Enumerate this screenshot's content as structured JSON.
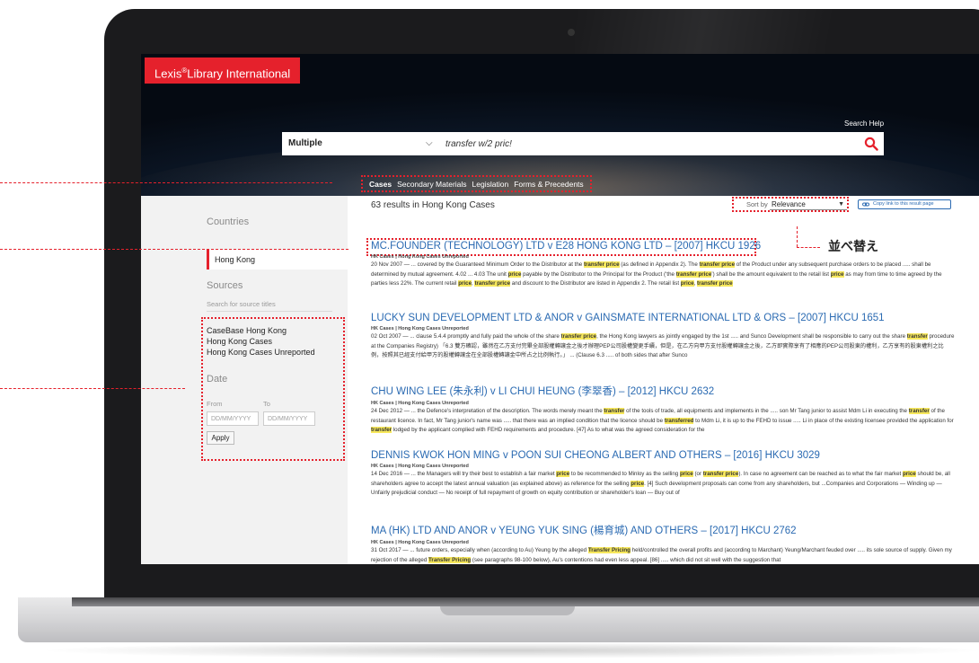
{
  "app": {
    "logo_text": "Lexis",
    "logo_reg": "®",
    "logo_suffix": "Library International"
  },
  "header": {
    "search_help": "Search Help",
    "search_scope": "Multiple",
    "search_query": "transfer w/2 pric!",
    "tabs": [
      {
        "label": "Cases",
        "active": true
      },
      {
        "label": "Secondary Materials",
        "active": false
      },
      {
        "label": "Legislation",
        "active": false
      },
      {
        "label": "Forms & Precedents",
        "active": false
      }
    ]
  },
  "sidebar": {
    "countries_heading": "Countries",
    "selected_country": "Hong Kong",
    "sources_heading": "Sources",
    "source_search_placeholder": "Search for source titles",
    "sources": [
      "CaseBase Hong Kong",
      "Hong Kong Cases",
      "Hong Kong Cases Unreported"
    ],
    "date_heading": "Date",
    "date_from_label": "From",
    "date_to_label": "To",
    "date_placeholder": "DD/MM/YYYY",
    "apply_label": "Apply"
  },
  "results": {
    "count_text": "63 results in Hong Kong Cases",
    "sort_label": "Sort by",
    "sort_value": "Relevance",
    "copy_link_label": "Copy link to this result page",
    "items": [
      {
        "title": "MC.FOUNDER (TECHNOLOGY) LTD v E28 HONG KONG LTD – [2007] HKCU 1926",
        "source": "HK Cases | Hong Kong Cases Unreported",
        "snippet": [
          [
            "20 Nov 2007 — ... covered by the Guaranteed Minimum Order to the Distributor at the ",
            false
          ],
          [
            "transfer price",
            true
          ],
          [
            " (as defined in Appendix 2). The ",
            false
          ],
          [
            "transfer price",
            true
          ],
          [
            " of the Product under any subsequent purchase orders to be placed ..... shall be determined by mutual agreement. 4.02 ... 4.03 The unit ",
            false
          ],
          [
            "price",
            true
          ],
          [
            " payable by the Distributor to the Principal for the Product (‘the ",
            false
          ],
          [
            "transfer price",
            true
          ],
          [
            "’) shall be the amount equivalent to the retail list ",
            false
          ],
          [
            "price",
            true
          ],
          [
            " as may from time to time agreed by the parties less 22%. The current retail ",
            false
          ],
          [
            "price",
            true
          ],
          [
            ", ",
            false
          ],
          [
            "transfer price",
            true
          ],
          [
            " and discount to the Distributor are listed in Appendix 2. The retail list ",
            false
          ],
          [
            "price",
            true
          ],
          [
            ", ",
            false
          ],
          [
            "transfer price",
            true
          ]
        ]
      },
      {
        "title": "LUCKY SUN DEVELOPMENT LTD & ANOR v GAINSMATE INTERNATIONAL LTD & ORS – [2007] HKCU 1651",
        "source": "HK Cases | Hong Kong Cases Unreported",
        "snippet": [
          [
            "02 Oct 2007 — ... clause 5.4.4 promptly and fully paid the whole of the share ",
            false
          ],
          [
            "transfer price",
            true
          ],
          [
            ", the Hong Kong lawyers as jointly engaged by the 1st ..... and Sunco Development shall be responsible to carry out the share ",
            false
          ],
          [
            "transfer",
            true
          ],
          [
            " procedure at the Companies Registry) 「6.3 雙方確認，雖然在乙方支付完畢全部股權轉讓金之後才辦理PEP公司股權變更手續，但是，在乙方向甲方支付股權轉讓金之後，乙方即實際享有了相應的PEP公司股東的權利，乙方享有的股東權利之比例，按照其已經支付給甲方的股權轉讓金在全部股權轉讓金中所占之比例執行。」 ... (Clause 6.3 ..... of both sides that after Sunco",
            false
          ]
        ]
      },
      {
        "title": "CHU WING LEE (朱永利) v LI CHUI HEUNG (李翠香) – [2012] HKCU 2632",
        "source": "HK Cases | Hong Kong Cases Unreported",
        "snippet": [
          [
            "24 Dec 2012 — ... the Defence's interpretation of the description. The words merely meant the ",
            false
          ],
          [
            "transfer",
            true
          ],
          [
            " of the tools of trade, all equipments and implements in the ..... son Mr Tang junior to assist Mdm Li in executing the ",
            false
          ],
          [
            "transfer",
            true
          ],
          [
            " of the restaurant licence. In fact, Mr Tang junior's name was ..... that there was an implied condition that the licence should be ",
            false
          ],
          [
            "transferred",
            true
          ],
          [
            " to Mdm Li, it is up to the FEHD to issue ..... Li in place of the existing licensee provided the application for ",
            false
          ],
          [
            "transfer",
            true
          ],
          [
            " lodged by the applicant complied with FEHD requirements and procedure. [47] As to what was the agreed consideration for the",
            false
          ]
        ]
      },
      {
        "title": "DENNIS KWOK HON MING v POON SUI CHEONG ALBERT AND OTHERS – [2016] HKCU 3029",
        "source": "HK Cases | Hong Kong Cases Unreported",
        "snippet": [
          [
            "14 Dec 2016 — ... the Managers will try their best to establish a fair market ",
            false
          ],
          [
            "price",
            true
          ],
          [
            " to be recommended to Minloy as the selling ",
            false
          ],
          [
            "price",
            true
          ],
          [
            " (or ",
            false
          ],
          [
            "transfer price",
            true
          ],
          [
            "). In case no agreement can be reached as to what the fair market ",
            false
          ],
          [
            "price",
            true
          ],
          [
            " should be, all shareholders agree to accept the latest annual valuation (as explained above) as reference for the selling ",
            false
          ],
          [
            "price",
            true
          ],
          [
            ". [4] Such development proposals can come from any shareholders, but ...Companies and Corporations — Winding up — Unfairly prejudicial conduct — No receipt of full repayment of growth on equity contribution or shareholder's loan — Buy out of",
            false
          ]
        ]
      },
      {
        "title": "MA (HK) LTD AND ANOR v YEUNG YUK SING (楊育城) AND OTHERS – [2017] HKCU 2762",
        "source": "HK Cases | Hong Kong Cases Unreported",
        "snippet": [
          [
            "31 Oct 2017 — ... future orders, especially when (according to Au) Yeung by the alleged ",
            false
          ],
          [
            "Transfer Pricing",
            true
          ],
          [
            " held/controlled the overall profits and (according to Marchant) Yeung/Marchant feuded over ..... its sole source of supply. Given my rejection of the alleged ",
            false
          ],
          [
            "Transfer Pricing",
            true
          ],
          [
            " (see paragraphs 98-100 below), Au's contentions had even less appeal. [86] ..... which did not sit well with the suggestion that",
            false
          ]
        ]
      }
    ]
  },
  "annotations": {
    "sort_label": "並べ替え"
  },
  "colors": {
    "brand_red": "#e5212c",
    "link_blue": "#2a6ab2",
    "highlight": "#f7e85c"
  }
}
